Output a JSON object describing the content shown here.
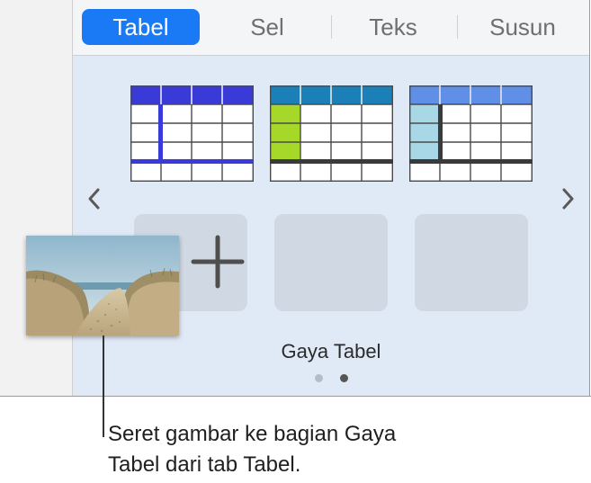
{
  "tabs": [
    {
      "label": "Tabel",
      "active": true
    },
    {
      "label": "Sel",
      "active": false
    },
    {
      "label": "Teks",
      "active": false
    },
    {
      "label": "Susun",
      "active": false
    }
  ],
  "table_styles": [
    {
      "name": "blue-header-style",
      "header_color": "#3a3ad9",
      "accent_color": "#3a3ad9"
    },
    {
      "name": "teal-lime-style",
      "header_color": "#1b80b8",
      "accent_color": "#a6d82a"
    },
    {
      "name": "light-blue-style",
      "header_color": "#5f8fe6",
      "accent_color": "#a8d8e6"
    }
  ],
  "section_label": "Gaya Tabel",
  "page_indicator": {
    "total": 2,
    "current": 2
  },
  "icons": {
    "prev": "chevron-left-icon",
    "next": "chevron-right-icon",
    "add": "plus-icon"
  },
  "dragged_image": "beach-dunes-photo",
  "caption_lines": [
    "Seret gambar ke bagian Gaya",
    "Tabel dari tab Tabel."
  ],
  "colors": {
    "accent": "#1a7af5",
    "panel_bg": "#e0e9f6"
  }
}
